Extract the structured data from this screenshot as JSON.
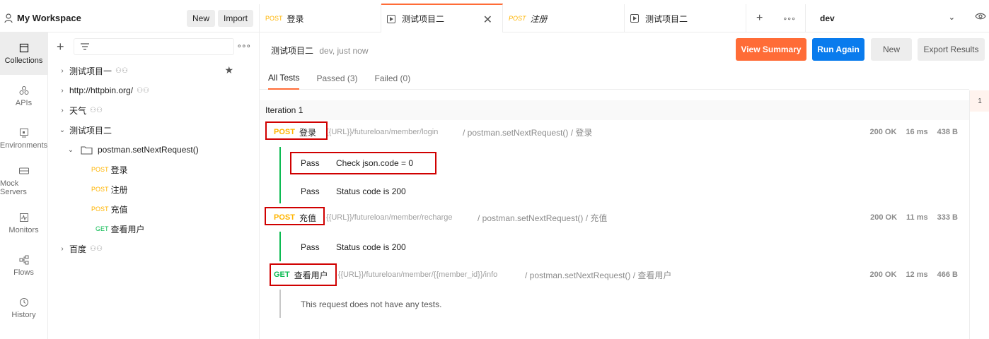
{
  "workspace": {
    "title": "My Workspace",
    "new_label": "New",
    "import_label": "Import"
  },
  "tabs": [
    {
      "method": "POST",
      "label": "登录",
      "italic": false,
      "type": "request"
    },
    {
      "method": "",
      "label": "测试项目二",
      "italic": false,
      "type": "runner",
      "active": true
    },
    {
      "method": "POST",
      "label": "注册",
      "italic": true,
      "type": "request"
    },
    {
      "method": "",
      "label": "测试项目二",
      "italic": false,
      "type": "runner"
    }
  ],
  "environment": {
    "name": "dev"
  },
  "rail": [
    {
      "label": "Collections",
      "icon": "collections-icon",
      "active": true
    },
    {
      "label": "APIs",
      "icon": "apis-icon"
    },
    {
      "label": "Environments",
      "icon": "environments-icon"
    },
    {
      "label": "Mock Servers",
      "icon": "mock-servers-icon"
    },
    {
      "label": "Monitors",
      "icon": "monitors-icon"
    },
    {
      "label": "Flows",
      "icon": "flows-icon"
    },
    {
      "label": "History",
      "icon": "history-icon"
    }
  ],
  "tree": [
    {
      "label": "测试项目一",
      "caret": "›",
      "shared": true,
      "starred": true
    },
    {
      "label": "http://httpbin.org/",
      "caret": "›",
      "shared": true
    },
    {
      "label": "天气",
      "caret": "›",
      "shared": true
    },
    {
      "label": "测试项目二",
      "caret": "⌄",
      "shared": false
    },
    {
      "label": "postman.setNextRequest()",
      "caret": "⌄",
      "folder": true
    },
    {
      "method": "POST",
      "label": "登录"
    },
    {
      "method": "POST",
      "label": "注册"
    },
    {
      "method": "POST",
      "label": "充值"
    },
    {
      "method": "GET",
      "label": "查看用户"
    },
    {
      "label": "百度",
      "caret": "›",
      "shared": true
    }
  ],
  "run": {
    "name": "测试项目二",
    "meta": "dev, just now",
    "view_summary": "View Summary",
    "run_again": "Run Again",
    "new_label": "New",
    "export_label": "Export Results"
  },
  "subtabs": [
    "All Tests",
    "Passed (3)",
    "Failed (0)"
  ],
  "iteration_label": "Iteration 1",
  "gutter_label": "1",
  "requests": [
    {
      "method": "POST",
      "name": "登录",
      "url": "{{URL}}/futureloan/member/login",
      "path": "/ postman.setNextRequest() / 登录",
      "status": "200 OK",
      "time": "16 ms",
      "size": "438 B",
      "tests": [
        {
          "status": "Pass",
          "msg": "Check json.code = 0"
        },
        {
          "status": "Pass",
          "msg": "Status code is 200"
        }
      ]
    },
    {
      "method": "POST",
      "name": "充值",
      "url": "{{URL}}/futureloan/member/recharge",
      "path": "/ postman.setNextRequest() / 充值",
      "status": "200 OK",
      "time": "11 ms",
      "size": "333 B",
      "tests": [
        {
          "status": "Pass",
          "msg": "Status code is 200"
        }
      ]
    },
    {
      "method": "GET",
      "name": "查看用户",
      "url": "{{URL}}/futureloan/member/{{member_id}}/info",
      "path": "/ postman.setNextRequest() / 查看用户",
      "status": "200 OK",
      "time": "12 ms",
      "size": "466 B",
      "tests": [],
      "no_tests": "This request does not have any tests."
    }
  ],
  "colors": {
    "accent": "#ff6c37",
    "primary": "#097bed",
    "post": "#ffb400",
    "get": "#0cbb52",
    "highlight_box": "#d00000",
    "pass_line": "#0cbb52"
  }
}
